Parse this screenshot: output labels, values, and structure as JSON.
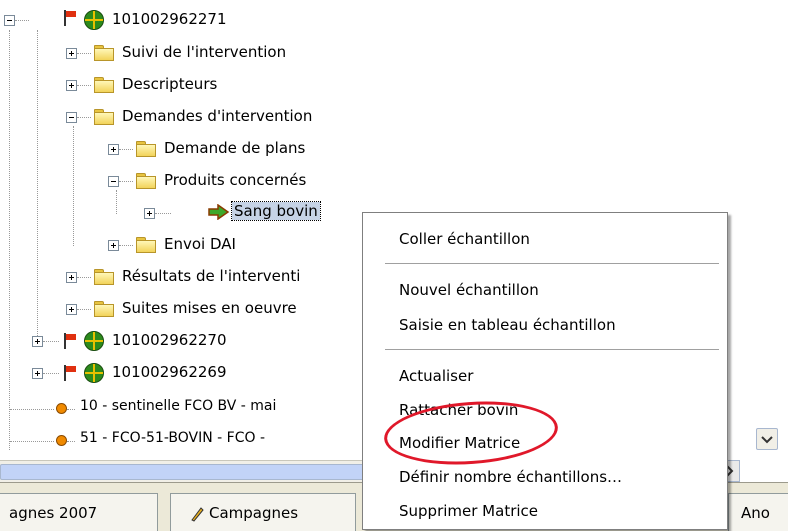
{
  "tree": {
    "nodes": [
      {
        "label": "101002962271"
      },
      {
        "label": "Suivi de l'intervention"
      },
      {
        "label": "Descripteurs"
      },
      {
        "label": "Demandes d'intervention"
      },
      {
        "label": "Demande de plans"
      },
      {
        "label": "Produits concernés"
      },
      {
        "label": "Sang bovin"
      },
      {
        "label": "Envoi DAI"
      },
      {
        "label": "Résultats de l'interventi"
      },
      {
        "label": "Suites mises en oeuvre"
      },
      {
        "label": "101002962270"
      },
      {
        "label": "101002962269"
      },
      {
        "label": "10 - sentinelle FCO BV - mai"
      },
      {
        "label": "51 - FCO-51-BOVIN - FCO -"
      }
    ]
  },
  "context_menu": {
    "items": [
      "Coller échantillon",
      "Nouvel échantillon",
      "Saisie en tableau échantillon",
      "Actualiser",
      "Rattacher bovin",
      "Modifier Matrice",
      "Définir nombre échantillons…",
      "Supprimer Matrice"
    ]
  },
  "tabs": {
    "items": [
      "agnes 2007",
      "Campagnes",
      "Ano"
    ]
  },
  "colors": {
    "highlight_ellipse": "#e0182a",
    "selection": "#c6d3e6"
  }
}
